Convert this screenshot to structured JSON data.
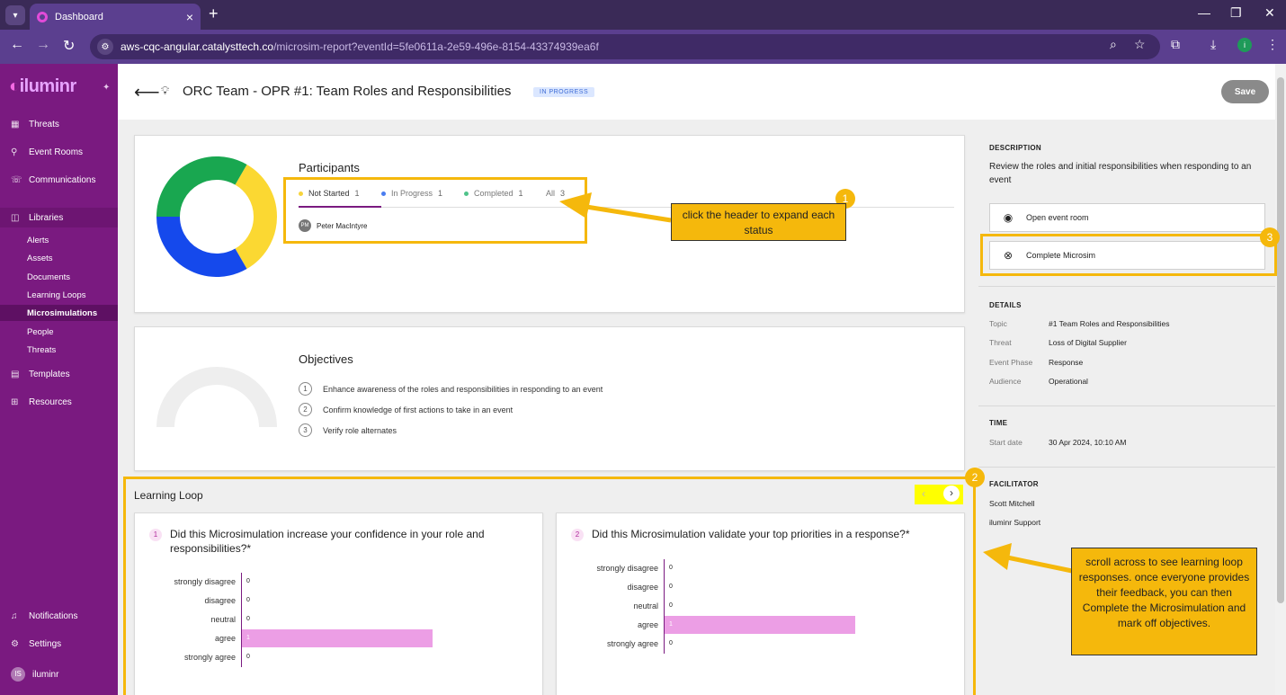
{
  "browser": {
    "tab_title": "Dashboard",
    "url_host": "aws-cqc-angular.catalysttech.co",
    "url_path": "/microsim-report?eventId=5fe0611a-2e59-496e-8154-43374939ea6f",
    "profile_initial": "i"
  },
  "sidebar": {
    "logo": "iluminr",
    "items": [
      {
        "label": "Threats",
        "icon": "threats-icon"
      },
      {
        "label": "Event Rooms",
        "icon": "event-rooms-icon"
      },
      {
        "label": "Communications",
        "icon": "communications-icon"
      },
      {
        "label": "Libraries",
        "icon": "libraries-icon"
      },
      {
        "label": "Templates",
        "icon": "templates-icon"
      },
      {
        "label": "Resources",
        "icon": "resources-icon"
      }
    ],
    "library_items": [
      "Alerts",
      "Assets",
      "Documents",
      "Learning Loops",
      "Microsimulations",
      "People",
      "Threats"
    ],
    "bottom_items": [
      {
        "label": "Notifications",
        "icon": "bell-icon"
      },
      {
        "label": "Settings",
        "icon": "gear-icon"
      }
    ],
    "user": {
      "initials": "IS",
      "name": "iluminr"
    }
  },
  "header": {
    "title": "ORC Team - OPR #1: Team Roles and Responsibilities",
    "status": "IN PROGRESS",
    "save_label": "Save"
  },
  "participants": {
    "title": "Participants",
    "tabs": [
      {
        "label": "Not Started",
        "count": "1",
        "color": "#f7d43c"
      },
      {
        "label": "In Progress",
        "count": "1",
        "color": "#4a7df0"
      },
      {
        "label": "Completed",
        "count": "1",
        "color": "#4fc38a"
      },
      {
        "label": "All",
        "count": "3"
      }
    ],
    "list": [
      {
        "initials": "PM",
        "name": "Peter MacIntyre"
      }
    ],
    "donut": [
      {
        "label": "Not Started",
        "value": 1,
        "color": "#fbd832"
      },
      {
        "label": "In Progress",
        "value": 1,
        "color": "#1549ec"
      },
      {
        "label": "Completed",
        "value": 1,
        "color": "#19a750"
      }
    ]
  },
  "objectives": {
    "title": "Objectives",
    "items": [
      "Enhance awareness of the roles and responsibilities in responding to an event",
      "Confirm knowledge of first actions to take in an event",
      "Verify role alternates"
    ]
  },
  "learning_loop": {
    "title": "Learning Loop",
    "questions": [
      {
        "num": "1",
        "text": "Did this Microsimulation increase your confidence in your role and responsibilities?*"
      },
      {
        "num": "2",
        "text": "Did this Microsimulation validate your top priorities in a response?*"
      }
    ]
  },
  "chart_data": [
    {
      "type": "bar",
      "categories": [
        "strongly disagree",
        "disagree",
        "neutral",
        "agree",
        "strongly agree"
      ],
      "values": [
        0,
        0,
        0,
        1,
        0
      ],
      "xlim": [
        0,
        1
      ]
    },
    {
      "type": "bar",
      "categories": [
        "strongly disagree",
        "disagree",
        "neutral",
        "agree",
        "strongly agree"
      ],
      "values": [
        0,
        0,
        0,
        1,
        0
      ],
      "xlim": [
        0,
        1
      ]
    }
  ],
  "right_panel": {
    "description_heading": "DESCRIPTION",
    "description": "Review the roles and initial responsibilities when responding to an event",
    "open_event_room": "Open event room",
    "complete_microsim": "Complete Microsim",
    "details_heading": "DETAILS",
    "details": [
      {
        "key": "Topic",
        "value": "#1 Team Roles and Responsibilities"
      },
      {
        "key": "Threat",
        "value": "Loss of Digital Supplier"
      },
      {
        "key": "Event Phase",
        "value": "Response"
      },
      {
        "key": "Audience",
        "value": "Operational"
      }
    ],
    "time_heading": "TIME",
    "start_key": "Start date",
    "start_value": "30 Apr 2024, 10:10 AM",
    "facilitator_heading": "FACILITATOR",
    "facilitators": [
      "Scott Mitchell",
      "iluminr Support"
    ]
  },
  "annotations": {
    "badge1": "1",
    "badge2": "2",
    "badge3": "3",
    "note1": "click the header to expand each status",
    "note2": "scroll across to see learning loop responses. once everyone provides their feedback, you can then Complete the Microsimulation and mark off objectives.",
    "color": "#f5b80c"
  }
}
